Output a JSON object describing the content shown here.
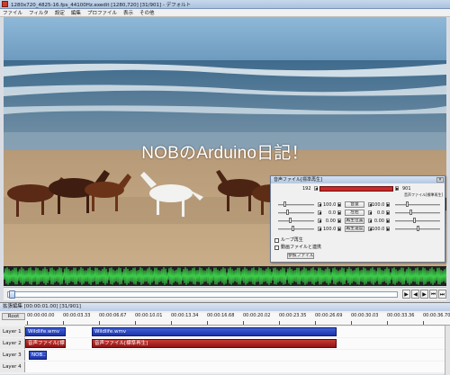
{
  "main_window": {
    "title": "1280x720_4825-16.fps_44100Hz.exedit [1280,720] [31/901] - デフォルト",
    "menu": [
      "ファイル",
      "フィルタ",
      "設定",
      "編集",
      "プロファイル",
      "表示",
      "その他"
    ]
  },
  "video": {
    "caption": "NOBのArduino日記！"
  },
  "transport": {
    "buttons": [
      "▶",
      "◀",
      "▶",
      "⏮",
      "⏭",
      "⏏"
    ]
  },
  "audio_dialog": {
    "title": "音声ファイル[標準再生]",
    "frame_start": "192",
    "frame_end": "901",
    "right_title": "音声ファイル[標準再生]",
    "rows": [
      {
        "value": "100.0",
        "button": "音量",
        "right_value": "100.0"
      },
      {
        "value": "0.0",
        "button": "左右",
        "right_value": "0.0"
      },
      {
        "value": "0.00",
        "button": "再生位置",
        "right_value": "0.00"
      },
      {
        "value": "100.0",
        "button": "再生速度",
        "right_value": "100.0"
      }
    ],
    "checkbox_loop": "ループ再生",
    "checkbox_link": "動画ファイルと連携",
    "ref_button": "参照ファイル"
  },
  "timeline": {
    "title": "拡張編集 [00:00:01.00] [31/901]",
    "root_label": "Root",
    "ruler": [
      "00:00:00.00",
      "00:00:03.33",
      "00:00:06.67",
      "00:00:10.01",
      "00:00:13.34",
      "00:00:16.68",
      "00:00:20.02",
      "00:00:23.35",
      "00:00:26.69",
      "00:00:30.03",
      "00:00:33.36",
      "00:00:36.70"
    ],
    "layers": [
      {
        "label": "Layer 1",
        "clips": [
          {
            "type": "video",
            "text": "Wildlife.wmv"
          },
          {
            "type": "video",
            "text": "Wildlife.wmv"
          }
        ]
      },
      {
        "label": "Layer 2",
        "clips": [
          {
            "type": "audio",
            "text": "音声ファイル[標準再"
          },
          {
            "type": "audio",
            "text": "音声ファイル[標準再生]"
          }
        ]
      },
      {
        "label": "Layer 3",
        "clips": [
          {
            "type": "text",
            "text": "NOB..."
          }
        ]
      },
      {
        "label": "Layer 4",
        "clips": []
      }
    ]
  }
}
